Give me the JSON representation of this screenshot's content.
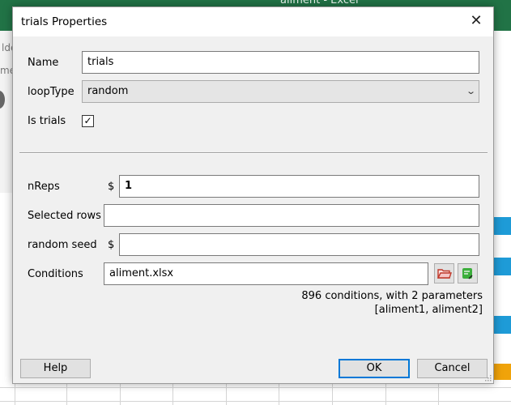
{
  "background_window": {
    "title": "aliment  -  Excel",
    "fragment_1": "lde",
    "fragment_2": "me"
  },
  "dialog": {
    "title": "trials Properties",
    "close_glyph": "✕",
    "name": {
      "label": "Name",
      "value": "trials"
    },
    "loop_type": {
      "label": "loopType",
      "value": "random"
    },
    "is_trials": {
      "label": "Is trials",
      "checked": true,
      "check_glyph": "✓"
    },
    "nreps": {
      "label": "nReps",
      "prefix": "$",
      "value": "1"
    },
    "selected_rows": {
      "label": "Selected rows",
      "value": ""
    },
    "random_seed": {
      "label": "random seed",
      "prefix": "$",
      "value": ""
    },
    "conditions": {
      "label": "Conditions",
      "value": "aliment.xlsx",
      "info_line_1": "896 conditions, with 2 parameters",
      "info_line_2": "[aliment1, aliment2]",
      "browse_icon": "folder-open-icon",
      "edit_icon": "edit-conditions-icon"
    },
    "buttons": {
      "help": "Help",
      "ok": "OK",
      "cancel": "Cancel"
    },
    "colors": {
      "accent": "#0078d7",
      "excel_green": "#217346",
      "folder_red": "#c0392b",
      "edit_green": "#3cae3c"
    }
  }
}
